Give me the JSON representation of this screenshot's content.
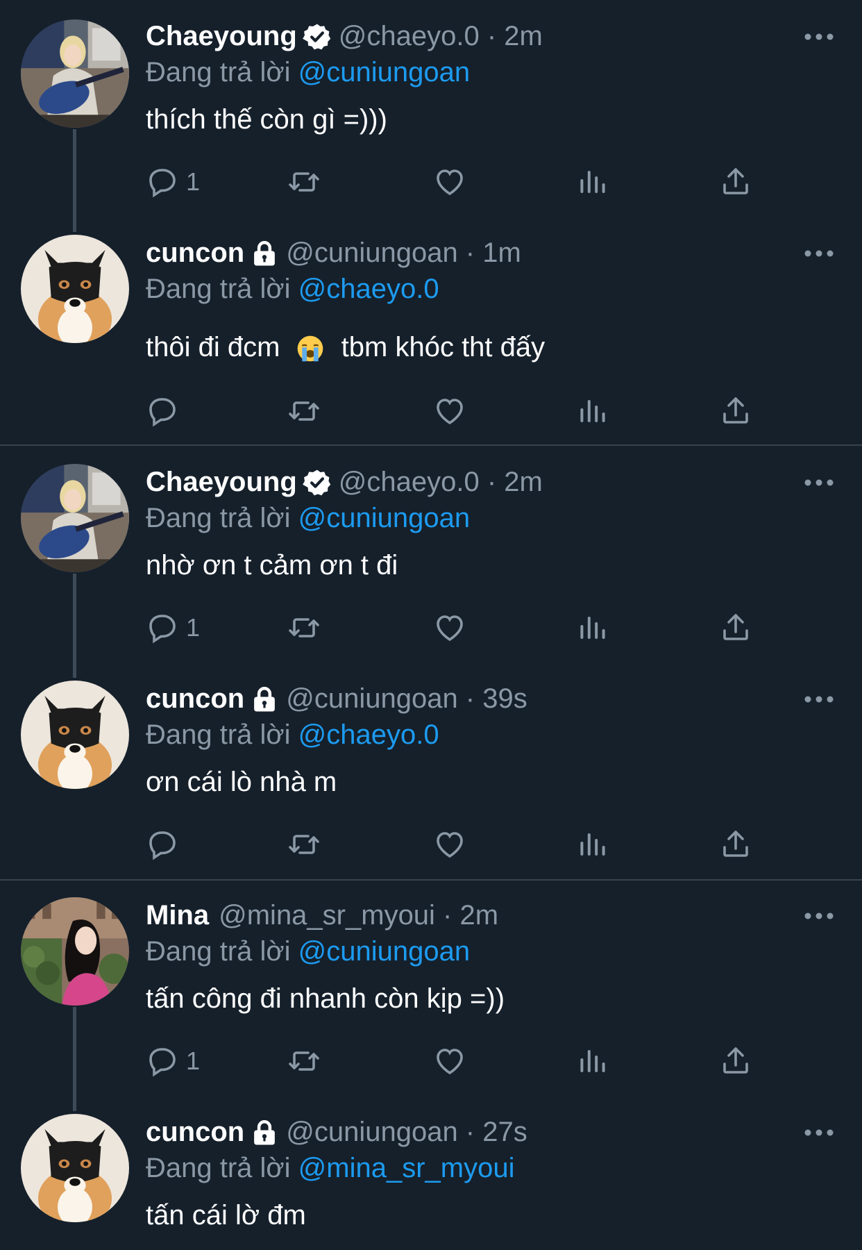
{
  "reply_prefix": "Đang trả lời",
  "tweets": [
    {
      "name": "Chaeyoung",
      "handle": "@chaeyo.0 · 2m",
      "reply_to": "@cuniungoan",
      "text": "thích thế còn gì =)))",
      "reply_count": "1",
      "badge": "verified-icon",
      "avatar": "guitar-girl"
    },
    {
      "name": "cuncon",
      "handle": "@cuniungoan · 1m",
      "reply_to": "@chaeyo.0",
      "text_a": "thôi đi đcm",
      "text_b": "tbm khóc tht đấy",
      "reply_count": "",
      "badge": "lock-icon",
      "avatar": "corgi-batman"
    },
    {
      "name": "Chaeyoung",
      "handle": "@chaeyo.0 · 2m",
      "reply_to": "@cuniungoan",
      "text": "nhờ ơn t cảm ơn t đi",
      "reply_count": "1",
      "badge": "verified-icon",
      "avatar": "guitar-girl"
    },
    {
      "name": "cuncon",
      "handle": "@cuniungoan · 39s",
      "reply_to": "@chaeyo.0",
      "text": "ơn cái lò nhà m",
      "reply_count": "",
      "badge": "lock-icon",
      "avatar": "corgi-batman"
    },
    {
      "name": "Mina",
      "handle": "@mina_sr_myoui · 2m",
      "reply_to": "@cuniungoan",
      "text": "tấn công đi nhanh còn kịp =))",
      "reply_count": "1",
      "badge": "",
      "avatar": "pink-shirt-girl"
    },
    {
      "name": "cuncon",
      "handle": "@cuniungoan · 27s",
      "reply_to": "@mina_sr_myoui",
      "text": "tấn cái lờ đm",
      "reply_count": "",
      "badge": "lock-icon",
      "avatar": "corgi-batman"
    }
  ],
  "colors": {
    "background": "#15202b",
    "secondary_text": "#8b98a5",
    "accent": "#1d9bf0",
    "divider": "#38444d"
  }
}
